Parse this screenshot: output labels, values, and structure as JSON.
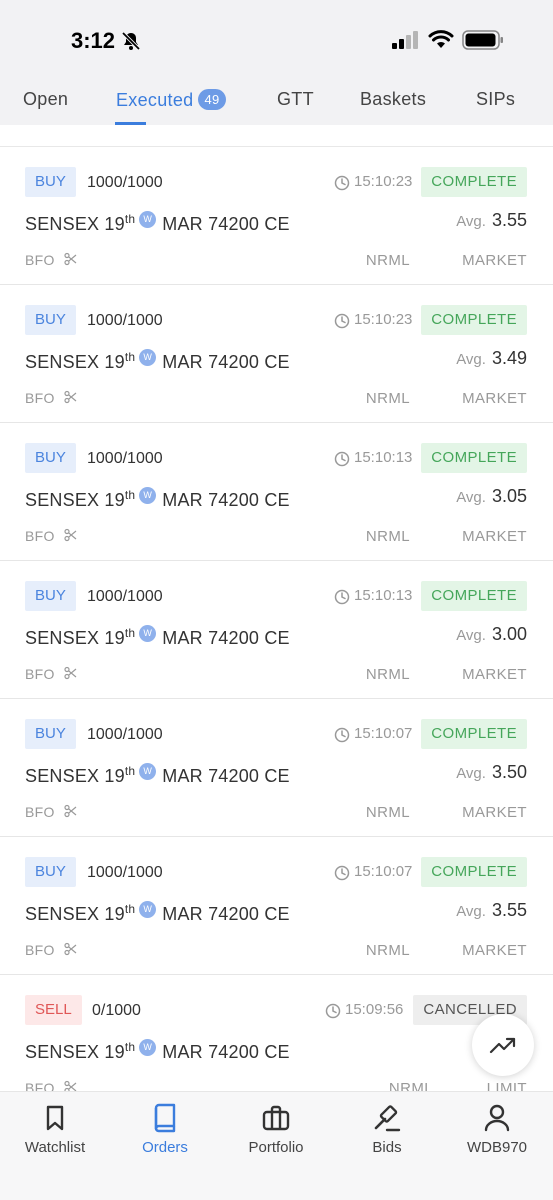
{
  "status_bar": {
    "time": "3:12"
  },
  "tabs": [
    {
      "label": "Open"
    },
    {
      "label": "Executed",
      "badge": "49"
    },
    {
      "label": "GTT"
    },
    {
      "label": "Baskets"
    },
    {
      "label": "SIPs"
    }
  ],
  "orders": [
    {
      "side": "BUY",
      "qty": "1000/1000",
      "time": "15:10:23",
      "status": "COMPLETE",
      "symbol": "SENSEX 19",
      "sup": "th",
      "weekly": "W",
      "expiry": "MAR 74200 CE",
      "avg_label": "Avg.",
      "avg": "3.55",
      "exchange": "BFO",
      "product": "NRML",
      "order_type": "MARKET"
    },
    {
      "side": "BUY",
      "qty": "1000/1000",
      "time": "15:10:23",
      "status": "COMPLETE",
      "symbol": "SENSEX 19",
      "sup": "th",
      "weekly": "W",
      "expiry": "MAR 74200 CE",
      "avg_label": "Avg.",
      "avg": "3.49",
      "exchange": "BFO",
      "product": "NRML",
      "order_type": "MARKET"
    },
    {
      "side": "BUY",
      "qty": "1000/1000",
      "time": "15:10:13",
      "status": "COMPLETE",
      "symbol": "SENSEX 19",
      "sup": "th",
      "weekly": "W",
      "expiry": "MAR 74200 CE",
      "avg_label": "Avg.",
      "avg": "3.05",
      "exchange": "BFO",
      "product": "NRML",
      "order_type": "MARKET"
    },
    {
      "side": "BUY",
      "qty": "1000/1000",
      "time": "15:10:13",
      "status": "COMPLETE",
      "symbol": "SENSEX 19",
      "sup": "th",
      "weekly": "W",
      "expiry": "MAR 74200 CE",
      "avg_label": "Avg.",
      "avg": "3.00",
      "exchange": "BFO",
      "product": "NRML",
      "order_type": "MARKET"
    },
    {
      "side": "BUY",
      "qty": "1000/1000",
      "time": "15:10:07",
      "status": "COMPLETE",
      "symbol": "SENSEX 19",
      "sup": "th",
      "weekly": "W",
      "expiry": "MAR 74200 CE",
      "avg_label": "Avg.",
      "avg": "3.50",
      "exchange": "BFO",
      "product": "NRML",
      "order_type": "MARKET"
    },
    {
      "side": "BUY",
      "qty": "1000/1000",
      "time": "15:10:07",
      "status": "COMPLETE",
      "symbol": "SENSEX 19",
      "sup": "th",
      "weekly": "W",
      "expiry": "MAR 74200 CE",
      "avg_label": "Avg.",
      "avg": "3.55",
      "exchange": "BFO",
      "product": "NRML",
      "order_type": "MARKET"
    },
    {
      "side": "SELL",
      "qty": "0/1000",
      "time": "15:09:56",
      "status": "CANCELLED",
      "symbol": "SENSEX 19",
      "sup": "th",
      "weekly": "W",
      "expiry": "MAR 74200 CE",
      "exchange": "BFO",
      "product": "NRML",
      "order_type": "LIMIT"
    }
  ],
  "bottom_nav": [
    {
      "label": "Watchlist",
      "icon": "bookmark-icon"
    },
    {
      "label": "Orders",
      "icon": "book-icon"
    },
    {
      "label": "Portfolio",
      "icon": "briefcase-icon"
    },
    {
      "label": "Bids",
      "icon": "gavel-icon"
    },
    {
      "label": "WDB970",
      "icon": "user-icon"
    }
  ],
  "fab": {
    "icon": "trending-up-icon"
  },
  "colors": {
    "accent": "#3b7ddd",
    "buy": "#4b84de",
    "sell": "#e05757",
    "complete": "#45a65a"
  }
}
